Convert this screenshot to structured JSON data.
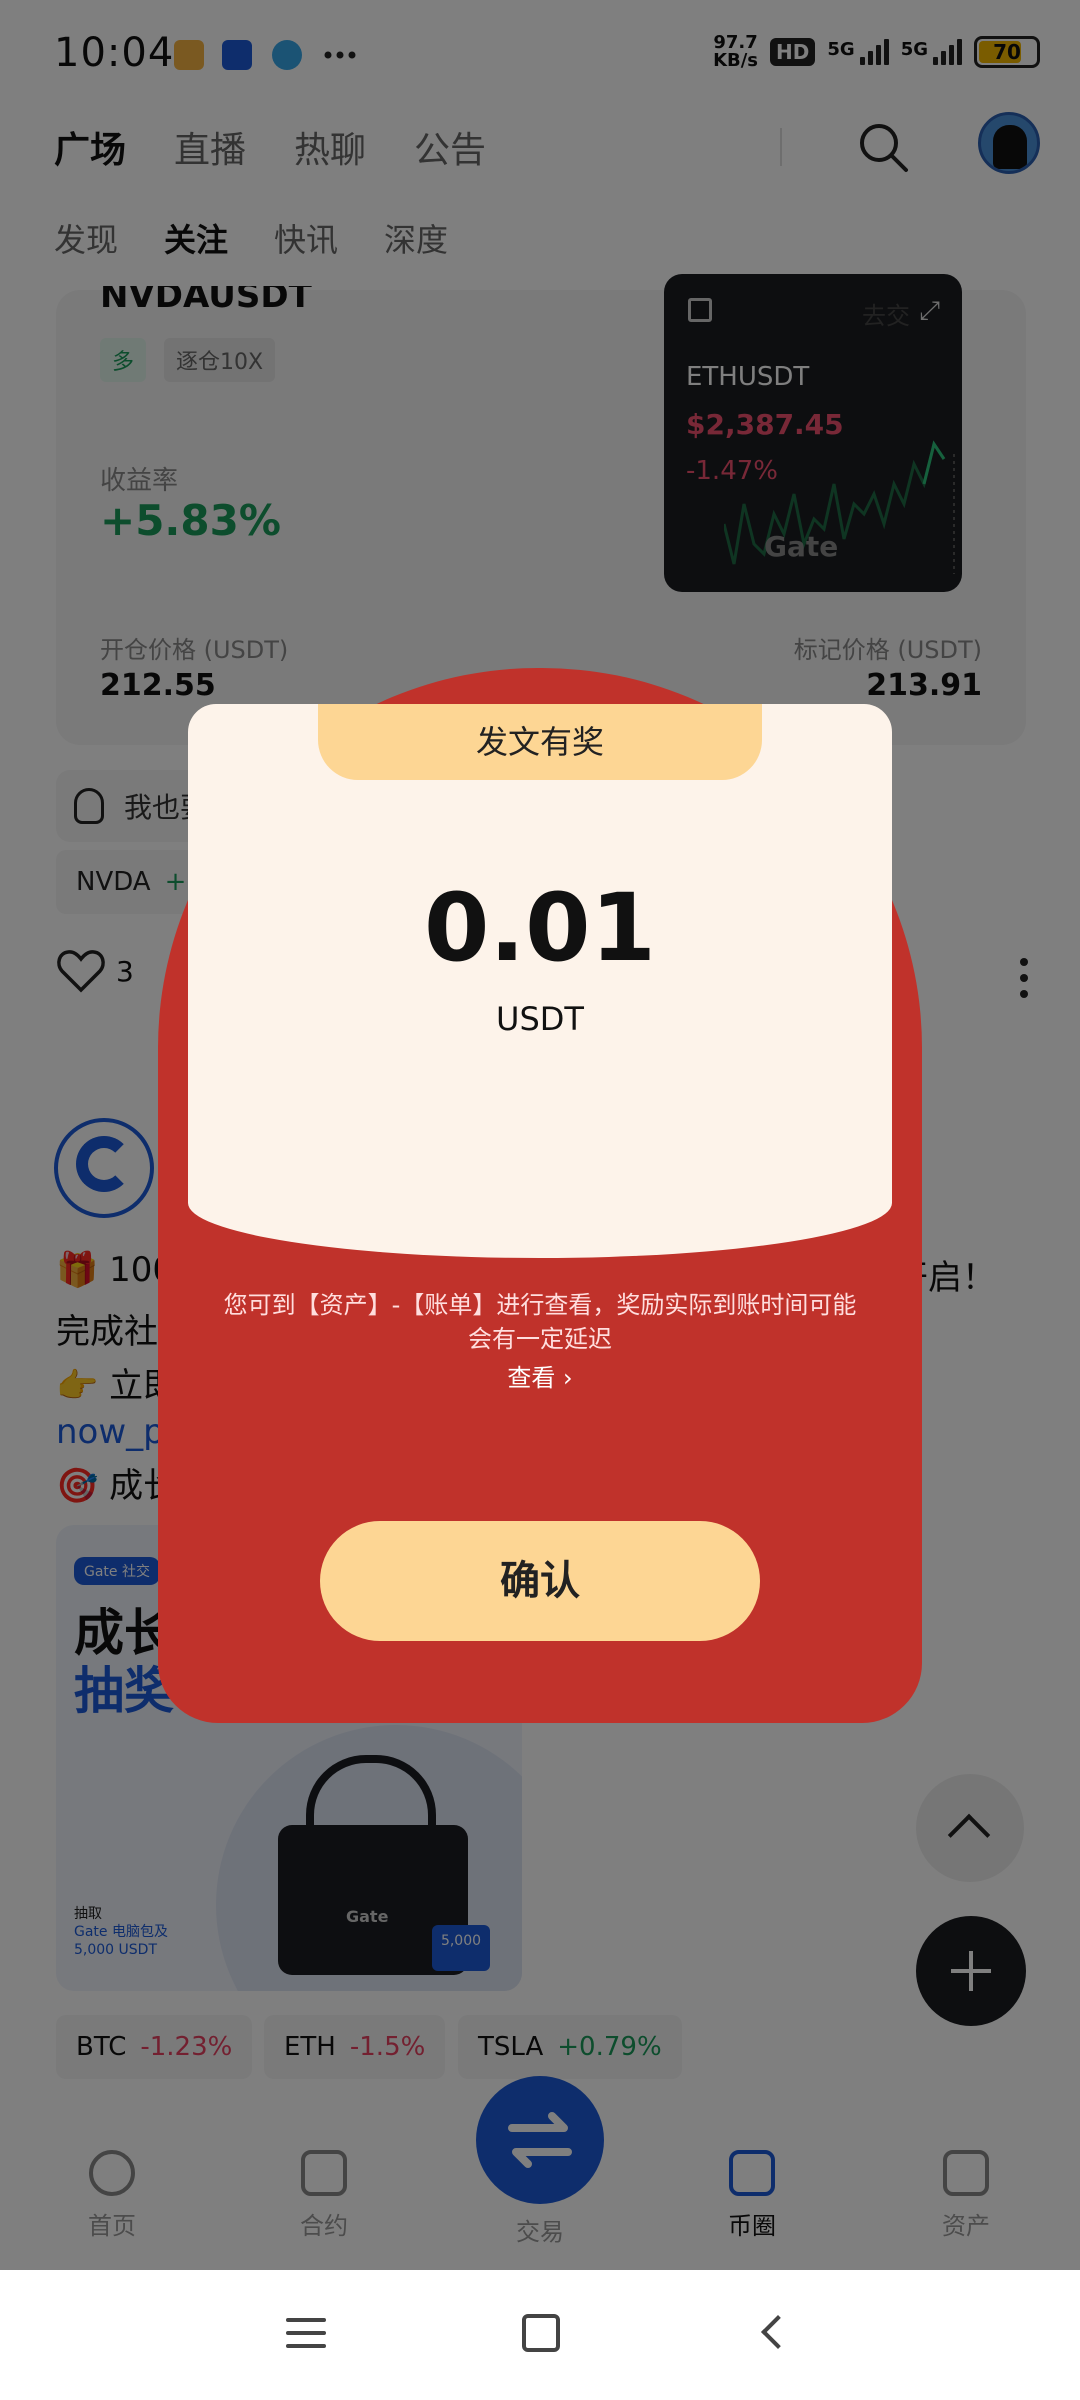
{
  "status_bar": {
    "time": "10:04",
    "net_speed_value": "97.7",
    "net_speed_unit": "KB/s",
    "hd": "HD",
    "signal1": "5G",
    "signal2": "5G",
    "battery": "70"
  },
  "top_nav": {
    "tabs": [
      {
        "label": "广场",
        "active": true
      },
      {
        "label": "直播"
      },
      {
        "label": "热聊"
      },
      {
        "label": "公告"
      }
    ]
  },
  "sub_nav": {
    "tabs": [
      {
        "label": "发现"
      },
      {
        "label": "关注",
        "active": true
      },
      {
        "label": "快讯"
      },
      {
        "label": "深度"
      }
    ]
  },
  "position_card": {
    "symbol": "NVDAUSDT",
    "side_tag": "多",
    "leverage_tag": "逐仓10X",
    "roi_label": "收益率",
    "roi_value": "+5.83%",
    "open_label": "开仓价格 (USDT)",
    "open_value": "212.55",
    "mark_label": "标记价格 (USDT)",
    "mark_value": "213.91"
  },
  "widget": {
    "symbol": "ETHUSDT",
    "price": "$2,387.45",
    "change": "-1.47%",
    "brand": "Gate",
    "overlay_text": "去交"
  },
  "hint": {
    "text": "我也要"
  },
  "coin_tags": [
    {
      "symbol": "NVDA",
      "change": "+1"
    }
  ],
  "likes": {
    "count": "3"
  },
  "post": {
    "line1": "🎁 100",
    "line1_right": "开启！",
    "line2": "完成社",
    "line3": "👉 立即",
    "line4": "now_pc",
    "line5": "🎯 成长",
    "banner": {
      "chip": "Gate 社交",
      "title1": "成长",
      "title2": "抽奖",
      "sub1": "抽取",
      "sub2": "Gate 电脑包及",
      "sub3": "5,000 USDT",
      "bag_brand": "Gate",
      "badge": "5,000"
    }
  },
  "bottom_tags": [
    {
      "symbol": "BTC",
      "change": "-1.23%"
    },
    {
      "symbol": "ETH",
      "change": "-1.5%"
    },
    {
      "symbol": "TSLA",
      "change": "+0.79%"
    }
  ],
  "tabbar": {
    "items": [
      {
        "label": "首页"
      },
      {
        "label": "合约"
      },
      {
        "label": "交易"
      },
      {
        "label": "币圈",
        "active": true
      },
      {
        "label": "资产"
      }
    ]
  },
  "modal": {
    "header": "发文有奖",
    "amount": "0.01",
    "unit": "USDT",
    "note_line1": "您可到【资产】-【账单】进行查看，奖励实际到账时间可能",
    "note_line2": "会有一定延迟",
    "view_link": "查看",
    "confirm": "确认"
  },
  "colors": {
    "accent_blue": "#1c5bd8",
    "up_green": "#1a9a5a",
    "down_red": "#e64060",
    "packet_red": "#c0322b",
    "packet_gold": "#fdd694"
  }
}
